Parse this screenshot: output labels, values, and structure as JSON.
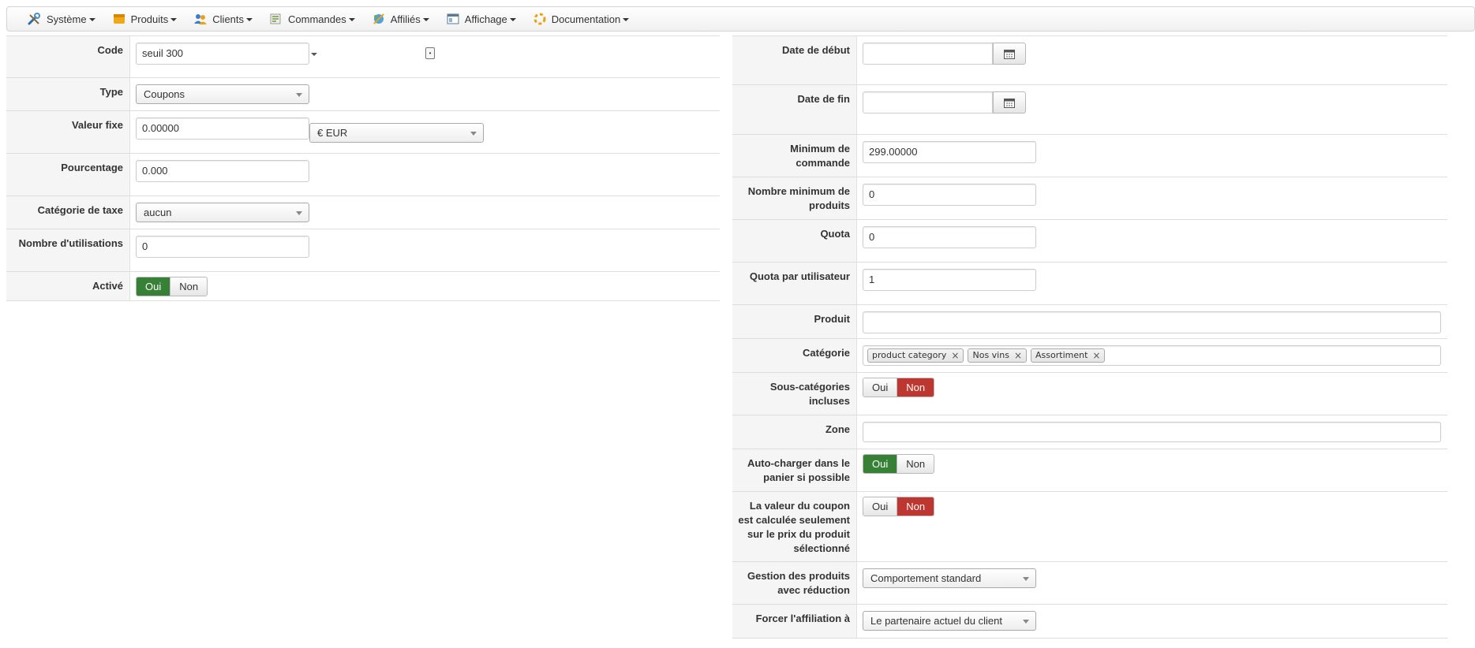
{
  "menu": [
    {
      "label": "Système",
      "icon": "tools-icon"
    },
    {
      "label": "Produits",
      "icon": "box-icon"
    },
    {
      "label": "Clients",
      "icon": "users-icon"
    },
    {
      "label": "Commandes",
      "icon": "cart-icon"
    },
    {
      "label": "Affiliés",
      "icon": "affiliates-icon"
    },
    {
      "label": "Affichage",
      "icon": "display-icon"
    },
    {
      "label": "Documentation",
      "icon": "help-icon"
    }
  ],
  "left": {
    "code": {
      "label": "Code",
      "value": "seuil 300"
    },
    "type": {
      "label": "Type",
      "value": "Coupons"
    },
    "valeur_fixe": {
      "label": "Valeur fixe",
      "value": "0.00000",
      "currency": "€ EUR"
    },
    "pourcentage": {
      "label": "Pourcentage",
      "value": "0.000"
    },
    "categorie_taxe": {
      "label": "Catégorie de taxe",
      "value": "aucun"
    },
    "nombre_utilisations": {
      "label": "Nombre d'utilisations",
      "value": "0"
    },
    "active": {
      "label": "Activé",
      "yes": "Oui",
      "no": "Non",
      "selected": "Oui"
    }
  },
  "right": {
    "date_debut": {
      "label": "Date de début",
      "value": ""
    },
    "date_fin": {
      "label": "Date de fin",
      "value": ""
    },
    "minimum_commande": {
      "label": "Minimum de commande",
      "value": "299.00000"
    },
    "nombre_min_produits": {
      "label": "Nombre minimum de produits",
      "value": "0"
    },
    "quota": {
      "label": "Quota",
      "value": "0"
    },
    "quota_utilisateur": {
      "label": "Quota par utilisateur",
      "value": "1"
    },
    "produit": {
      "label": "Produit",
      "value": ""
    },
    "categorie": {
      "label": "Catégorie",
      "tags": [
        "product category",
        "Nos vins",
        "Assortiment"
      ]
    },
    "sous_categories": {
      "label": "Sous-catégories incluses",
      "yes": "Oui",
      "no": "Non",
      "selected": "Non"
    },
    "zone": {
      "label": "Zone",
      "value": ""
    },
    "auto_charger": {
      "label": "Auto-charger dans le panier si possible",
      "yes": "Oui",
      "no": "Non",
      "selected": "Oui"
    },
    "valeur_coupon": {
      "label": "La valeur du coupon est calculée seulement sur le prix du produit sélectionné",
      "yes": "Oui",
      "no": "Non",
      "selected": "Non"
    },
    "gestion_produits": {
      "label": "Gestion des produits avec réduction",
      "value": "Comportement standard"
    },
    "forcer_affiliation": {
      "label": "Forcer l'affiliation à",
      "value": "Le partenaire actuel du client"
    }
  },
  "colors": {
    "toggle_yes": "#378137",
    "toggle_no": "#bd362f"
  }
}
